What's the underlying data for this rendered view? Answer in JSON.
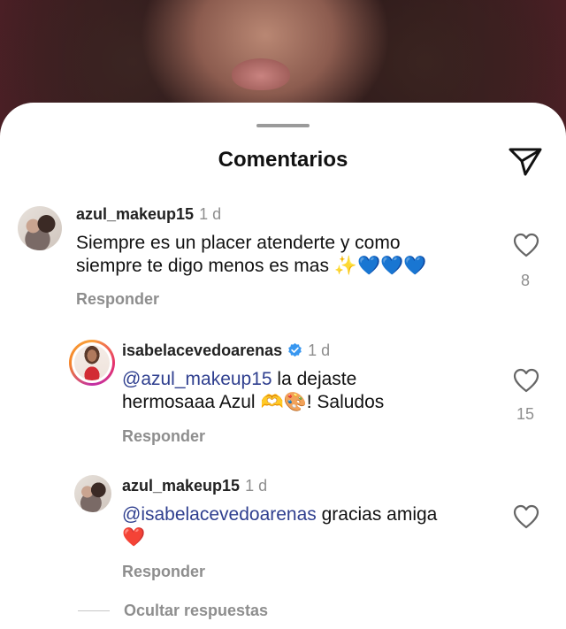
{
  "sheet": {
    "title": "Comentarios"
  },
  "icons": {
    "share": "paper-plane-icon",
    "like": "heart-outline-icon",
    "verified": "verified-badge-icon"
  },
  "colors": {
    "mention": "#2f3f8f",
    "muted": "#8e8e8e",
    "text": "#111111"
  },
  "comments": [
    {
      "username": "azul_makeup15",
      "time": "1 d",
      "line1": "Siempre es un placer atenderte y como",
      "line2": "siempre te digo menos es mas",
      "emojis": "✨💙💙💙",
      "reply_label": "Responder",
      "likes": "8"
    },
    {
      "username": "isabelacevedoarenas",
      "verified": true,
      "time": "1 d",
      "mention": "@azul_makeup15",
      "line1_rest": " la dejaste",
      "line2_start": "hermosaaa Azul",
      "emojis": "🫶🎨",
      "line2_end": "! Saludos",
      "reply_label": "Responder",
      "likes": "15"
    },
    {
      "username": "azul_makeup15",
      "time": "1 d",
      "mention": "@isabelacevedoarenas",
      "line1_rest": " gracias amiga",
      "emoji": "❤️",
      "reply_label": "Responder"
    }
  ],
  "hide_replies_label": "Ocultar respuestas"
}
